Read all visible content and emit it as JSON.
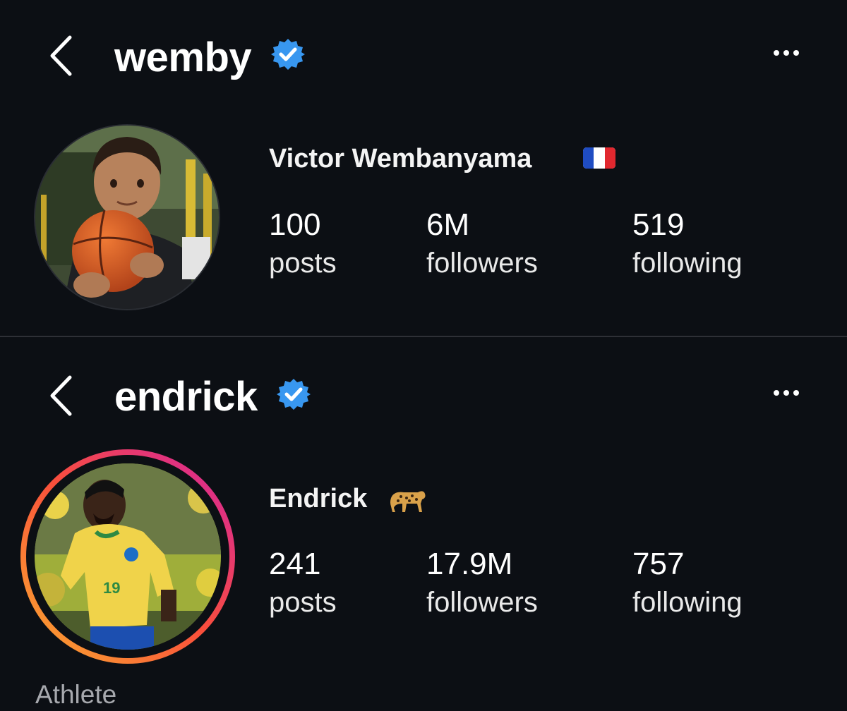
{
  "profiles": [
    {
      "username": "wemby",
      "verified": true,
      "display_name": "Victor Wembanyama",
      "name_emoji": "france-flag-icon",
      "stats": [
        {
          "value": "100",
          "label": "posts"
        },
        {
          "value": "6M",
          "label": "followers"
        },
        {
          "value": "519",
          "label": "following"
        }
      ],
      "story_ring": false
    },
    {
      "username": "endrick",
      "verified": true,
      "display_name": "Endrick",
      "name_emoji": "leopard-icon",
      "stats": [
        {
          "value": "241",
          "label": "posts"
        },
        {
          "value": "17.9M",
          "label": "followers"
        },
        {
          "value": "757",
          "label": "following"
        }
      ],
      "story_ring": true,
      "category": "Athlete"
    }
  ],
  "colors": {
    "background": "#0c0f14",
    "verified_badge": "#3897f0",
    "story_ring": [
      "#fbaa2f",
      "#f94f3b",
      "#d6249f"
    ]
  }
}
